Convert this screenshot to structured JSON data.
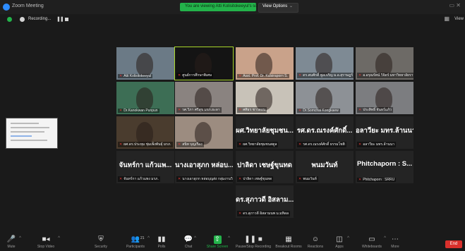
{
  "window": {
    "title": "Zoom Meeting",
    "window_controls": "▭  ✕"
  },
  "share_banner": {
    "text": "You are viewing Atti Kolisitokeeyul's screen",
    "view_options": "View Options",
    "view_options_chevron": "⌄"
  },
  "status": {
    "recording_label": "Recording...",
    "pause_glyph": "❚❚",
    "view_label": "View"
  },
  "tiles": [
    {
      "name": "Atti Kolisitokeeyul",
      "type": "video",
      "bg": "#6b7a86"
    },
    {
      "name": "ศูนย์การศึกษาพิเศษ",
      "type": "video",
      "bg": "#141414"
    },
    {
      "name": "Asst. Prof. Dr. Kulsiraporn S.",
      "type": "video",
      "bg": "#c9a28a"
    },
    {
      "name": "ดร.สมศักดิ์ พูลเจริญ ม.อ.สุราษฎร์",
      "type": "video",
      "bg": "#7e8a94"
    },
    {
      "name": "อ.อรุณรัตน์ วิจิตร์ มหาวิทยาลัยราชภัฏ",
      "type": "video",
      "bg": "#6d6a66"
    },
    {
      "name": "Dr.Kanokwan Punpun",
      "type": "video",
      "bg": "#3d6e55"
    },
    {
      "name": "รศ.วิภา ศรีสุข มรภ.ยะลา",
      "type": "video",
      "bg": "#8a8380"
    },
    {
      "name": "ศศิธร ชาวดอน",
      "type": "video",
      "bg": "#c8c2b8"
    },
    {
      "name": "Dr.Somchai Kongkaew",
      "type": "video",
      "bg": "#8d9196"
    },
    {
      "name": "ประสิทธิ์ จันทร์แก้ว",
      "type": "video",
      "bg": "#7c7d80"
    },
    {
      "name": "ผศ.ดร.ประทุม ชุ่มเพ็งพันธุ์ มรภ.",
      "type": "video",
      "bg": "#4a3c2e"
    },
    {
      "name": "สนิท บุญเรือง",
      "type": "video",
      "bg": "#9c8c80"
    },
    {
      "name": "ผศ.วิทยาลัยชุมชน...",
      "type": "name",
      "caption": "ผศ.วิทยาลัยชุมชนสตูล"
    },
    {
      "name": "รศ.ดร.ณรงค์ศักดิ์...",
      "type": "name",
      "caption": "รศ.ดร.ณรงค์ศักดิ์ ธรรมโชติ"
    },
    {
      "name": "อลาวียะ มทร.ล้านนา",
      "type": "name",
      "caption": "อลาวียะ มทร.ล้านนา"
    },
    {
      "name": "จันทร์กา แก้วแพ...",
      "type": "name",
      "caption": "จันทร์กา แก้วแพง มรภ."
    },
    {
      "name": "นางเอาสุภก หล่อบ...",
      "type": "name",
      "caption": "นางเอาสุภก หล่อบุญส่ง กลุ่มงานวิจัย"
    },
    {
      "name": "ปาลิดา เชษฐ์ขุนทด",
      "type": "name",
      "caption": "ปาลิดา เชษฐ์ขุนทด"
    },
    {
      "name": "พนมวันท์",
      "type": "name",
      "caption": "พนมวันท์"
    },
    {
      "name": "Phitchaporn : S...",
      "type": "name",
      "caption": "Phitchaporn : SRRU"
    },
    {
      "name": "ดร.สุภาวดี อิสลาม...",
      "type": "name",
      "caption": "ดร.สุภาวดี อิสลามนพ ม.มหิดล"
    }
  ],
  "toolbar": [
    {
      "label": "Mute",
      "icon": "🎤"
    },
    {
      "label": "Stop Video",
      "icon": "■◂"
    },
    {
      "label": "Security",
      "icon": "⛨"
    },
    {
      "label": "Participants",
      "icon": "👥",
      "count": "21"
    },
    {
      "label": "Polls",
      "icon": "▮▮"
    },
    {
      "label": "Chat",
      "icon": "💬"
    },
    {
      "label": "Share Screen",
      "icon": "⇧"
    },
    {
      "label": "Pause/Stop Recording",
      "icon": "❚❚ ■"
    },
    {
      "label": "Breakout Rooms",
      "icon": "▦"
    },
    {
      "label": "Reactions",
      "icon": "☺"
    },
    {
      "label": "Apps",
      "icon": "◫"
    },
    {
      "label": "Whiteboards",
      "icon": "▭"
    },
    {
      "label": "More",
      "icon": "⋯"
    }
  ],
  "end_button": {
    "label": "End"
  },
  "colors": {
    "accent_green": "#23b34a",
    "end_red": "#d9302c",
    "active_speaker": "#a8d629",
    "mic_muted": "#e53935"
  }
}
